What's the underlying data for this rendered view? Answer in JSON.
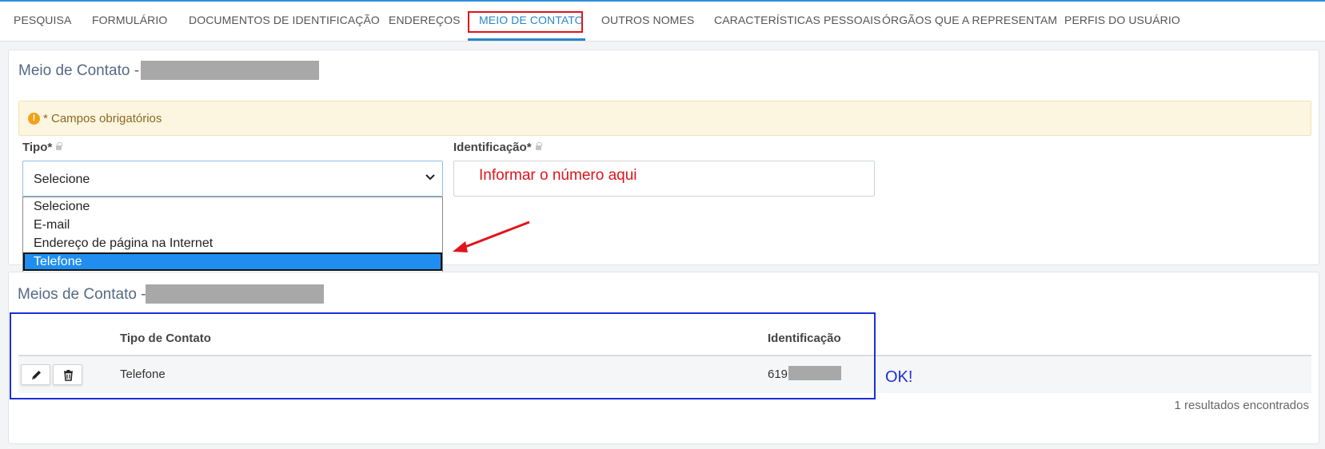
{
  "tabs": [
    {
      "label": "PESQUISA",
      "active": false
    },
    {
      "label": "FORMULÁRIO",
      "active": false
    },
    {
      "label": "DOCUMENTOS DE IDENTIFICAÇÃO",
      "active": false
    },
    {
      "label": "ENDEREÇOS",
      "active": false
    },
    {
      "label": "MEIO DE CONTATO",
      "active": true
    },
    {
      "label": "OUTROS NOMES",
      "active": false
    },
    {
      "label": "CARACTERÍSTICAS PESSOAIS",
      "active": false
    },
    {
      "label": "ÓRGÃOS QUE A REPRESENTAM",
      "active": false
    },
    {
      "label": "PERFIS DO USUÁRIO",
      "active": false
    }
  ],
  "form": {
    "title": "Meio de Contato -",
    "alert": "* Campos obrigatórios",
    "tipo_label": "Tipo*",
    "tipo_value": "Selecione",
    "tipo_options": [
      "Selecione",
      "E-mail",
      "Endereço de página na Internet",
      "Telefone"
    ],
    "tipo_highlighted": "Telefone",
    "identificacao_label": "Identificação*",
    "identificacao_value": ""
  },
  "annotations": {
    "input_hint": "Informar o número aqui",
    "ok": "OK!"
  },
  "list": {
    "title": "Meios de Contato -",
    "columns": [
      "Tipo de Contato",
      "Identificação"
    ],
    "rows": [
      {
        "tipo": "Telefone",
        "identificacao": "619"
      }
    ],
    "results": "1 resultados encontrados"
  },
  "icons": [
    "alert-icon",
    "lock-icon",
    "chevron-down-icon",
    "pencil-icon",
    "trash-icon",
    "arrow-icon"
  ],
  "colors": {
    "accent": "#2a86c8",
    "annotation_red": "#e0141b",
    "annotation_blue": "#1a2fd6",
    "alert_bg": "#fcf5df"
  }
}
